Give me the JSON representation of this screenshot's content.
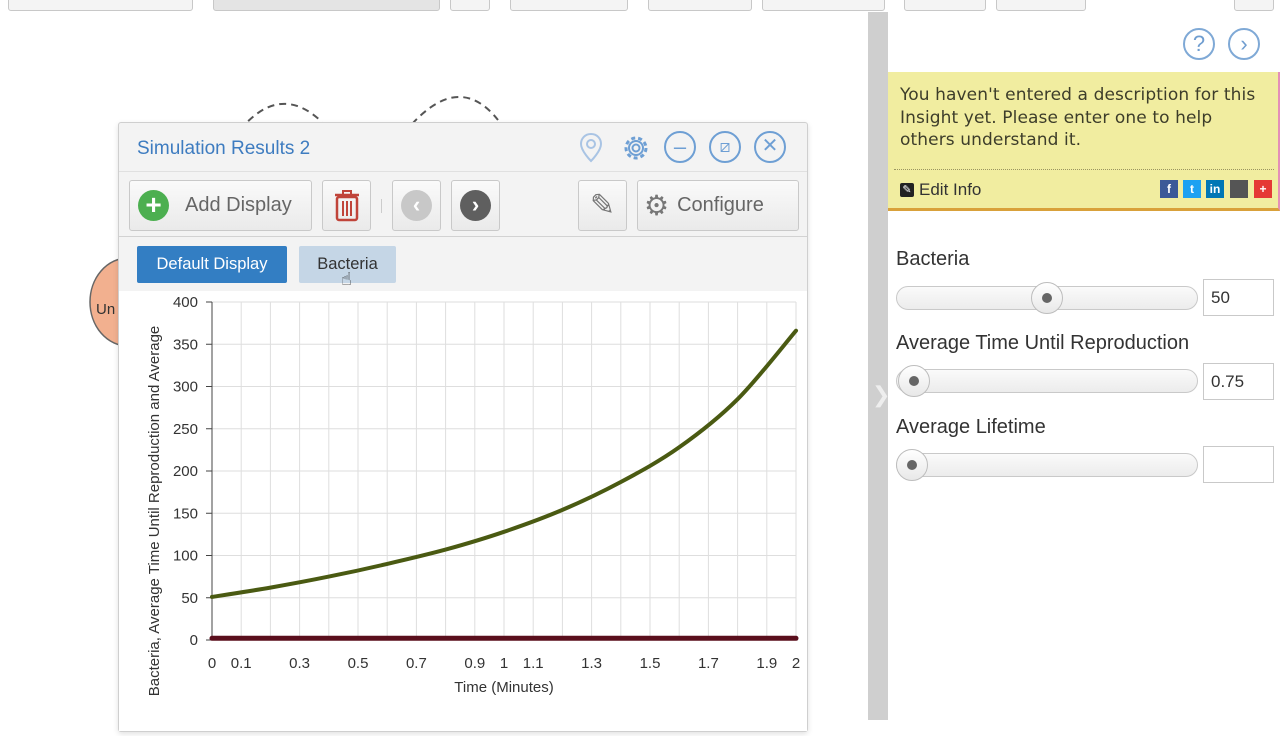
{
  "simulation": {
    "title": "Simulation Results 2",
    "toolbar": {
      "add_display_label": "Add Display",
      "configure_label": "Configure"
    },
    "tabs": [
      {
        "label": "Default Display",
        "active": true
      },
      {
        "label": "Bacteria",
        "active": false
      }
    ]
  },
  "diagram": {
    "partial_node_label": "Un"
  },
  "insight": {
    "note_text": "You haven't entered a description for this Insight yet. Please enter one to help others understand it.",
    "edit_info_label": "Edit Info",
    "social_icons": [
      "facebook-icon",
      "twitter-icon",
      "linkedin-icon",
      "embed-icon",
      "add-share-icon"
    ]
  },
  "parameters": [
    {
      "label": "Bacteria",
      "value": "50",
      "slider_position": 0.5
    },
    {
      "label": "Average Time Until Reproduction",
      "value": "0.75",
      "slider_position": 0.0
    },
    {
      "label": "Average Lifetime",
      "value": "",
      "slider_position": 0.0
    }
  ],
  "chart_data": {
    "type": "line",
    "xlabel": "Time (Minutes)",
    "ylabel": "Bacteria, Average Time Until Reproduction and Average",
    "xlim": [
      0,
      2
    ],
    "ylim": [
      0,
      400
    ],
    "x_ticks": [
      "0",
      "0.1",
      "0.3",
      "0.5",
      "0.7",
      "0.9",
      "1",
      "1.1",
      "1.3",
      "1.5",
      "1.7",
      "1.9",
      "2"
    ],
    "y_ticks": [
      "0",
      "50",
      "100",
      "150",
      "200",
      "250",
      "300",
      "350",
      "400"
    ],
    "grid": true,
    "series": [
      {
        "color": "#4a5a12",
        "x": [
          0,
          0.2,
          0.4,
          0.6,
          0.8,
          1.0,
          1.2,
          1.4,
          1.6,
          1.8,
          2.0
        ],
        "y": [
          51,
          62,
          75,
          90,
          107,
          128,
          154,
          187,
          228,
          285,
          366
        ]
      },
      {
        "color": "#5a0e1c",
        "x": [
          0,
          2
        ],
        "y": [
          2,
          2
        ]
      }
    ]
  }
}
